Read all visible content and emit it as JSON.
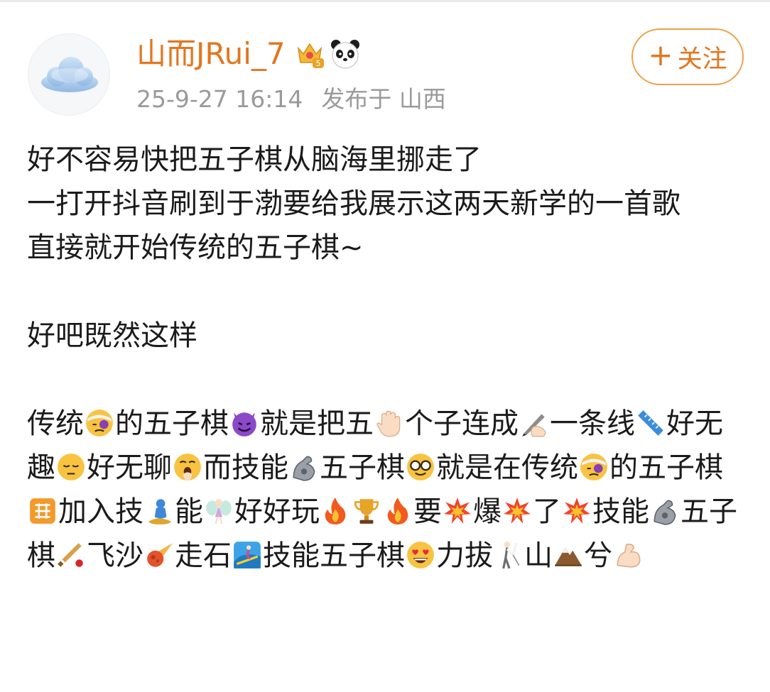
{
  "post": {
    "author": {
      "name": "山而JRui_7",
      "avatar_icon": "cloud-avatar-icon",
      "badges": [
        "crown-level-5-icon",
        "panda-icon"
      ]
    },
    "meta": {
      "time": "25-9-27 16:14",
      "location": "发布于 山西"
    },
    "follow_button": {
      "plus": "+",
      "label": "关注"
    },
    "accent_color": "#e3761e",
    "text": {
      "line1": "好不容易快把五子棋从脑海里挪走了",
      "line2": "一打开抖音刷到于渤要给我展示这两天新学的一首歌",
      "line3": "直接就开始传统的五子棋~",
      "line4": "好吧既然这样",
      "p3": [
        "传统",
        "的五子棋",
        "就是把五",
        "个子连成",
        "一条线",
        "好无趣",
        "好无聊",
        "而技能",
        "五子棋",
        "就是在传统",
        "的五子棋",
        "加入技",
        "能",
        "好好玩",
        "要",
        "爆",
        "了",
        "技能",
        "五子棋",
        "飞沙",
        "走石",
        "技能五子棋",
        "力拔",
        "山",
        "兮"
      ]
    }
  }
}
